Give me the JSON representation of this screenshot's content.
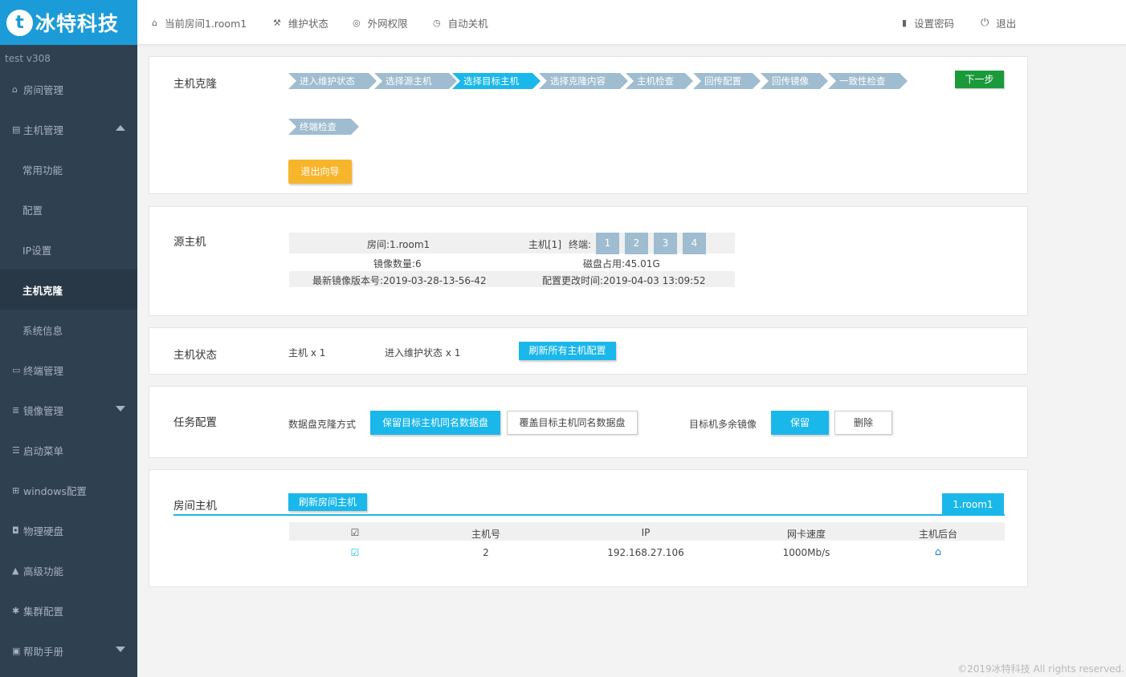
{
  "brand": {
    "logo_letter": "t",
    "name": "冰特科技",
    "version": "test  v308"
  },
  "sidebar": {
    "items": [
      {
        "icon": "home-icon",
        "glyph": "⌂",
        "label": "房间管理"
      },
      {
        "icon": "server-icon",
        "glyph": "▤",
        "label": "主机管理",
        "caret": "up"
      },
      {
        "label": "常用功能",
        "sub": true
      },
      {
        "label": "配置",
        "sub": true
      },
      {
        "label": "IP设置",
        "sub": true
      },
      {
        "label": "主机克隆",
        "sub": true,
        "active": true
      },
      {
        "label": "系统信息",
        "sub": true
      },
      {
        "icon": "monitor-icon",
        "glyph": "▭",
        "label": "终端管理"
      },
      {
        "icon": "database-icon",
        "glyph": "≣",
        "label": "镜像管理",
        "caret": "down"
      },
      {
        "icon": "list-icon",
        "glyph": "☰",
        "label": "启动菜单"
      },
      {
        "icon": "windows-icon",
        "glyph": "⊞",
        "label": "windows配置"
      },
      {
        "icon": "harddisk-icon",
        "glyph": "◘",
        "label": "物理硬盘"
      },
      {
        "icon": "warning-icon",
        "glyph": "▲",
        "label": "高级功能"
      },
      {
        "icon": "gear-icon",
        "glyph": "✱",
        "label": "集群配置"
      },
      {
        "icon": "book-icon",
        "glyph": "▣",
        "label": "帮助手册",
        "caret": "down"
      }
    ]
  },
  "topbar": {
    "current_room": "当前房间1.room1",
    "maintenance": "维护状态",
    "network": "外网权限",
    "auto_power": "自动关机",
    "set_password": "设置密码",
    "logout": "退出"
  },
  "clone": {
    "title": "主机克隆",
    "steps": [
      "进入维护状态",
      "选择源主机",
      "选择目标主机",
      "选择克隆内容",
      "主机检查",
      "回传配置",
      "回传镜像",
      "一致性检查",
      "终端检查"
    ],
    "active_step": 2,
    "next_label": "下一步",
    "exit_label": "退出向导"
  },
  "source": {
    "title": "源主机",
    "room": "房间:1.room1",
    "host": "主机[1]",
    "terminal_label": "终端:",
    "terminals": [
      "1",
      "2",
      "3",
      "4"
    ],
    "image_count": "镜像数量:6",
    "disk_used": "磁盘占用:45.01G",
    "latest_image": "最新镜像版本号:2019-03-28-13-56-42",
    "config_changed": "配置更改时间:2019-04-03 13:09:52"
  },
  "status": {
    "title": "主机状态",
    "hosts": "主机 x 1",
    "maintenance": "进入维护状态 x 1",
    "refresh_label": "刷新所有主机配置"
  },
  "task": {
    "title": "任务配置",
    "disk_mode_label": "数据盘克隆方式",
    "keep_disk": "保留目标主机同名数据盘",
    "overwrite_disk": "覆盖目标主机同名数据盘",
    "extra_image_label": "目标机多余镜像",
    "keep": "保留",
    "delete": "删除"
  },
  "room_hosts": {
    "title": "房间主机",
    "refresh_label": "刷新房间主机",
    "room_tab": "1.room1",
    "columns": [
      "☑",
      "主机号",
      "IP",
      "网卡速度",
      "主机后台"
    ],
    "rows": [
      {
        "check": "☑",
        "host_no": "2",
        "ip": "192.168.27.106",
        "speed": "1000Mb/s",
        "admin": "⌂"
      }
    ]
  },
  "footer": "©2019冰特科技 All rights reserved."
}
